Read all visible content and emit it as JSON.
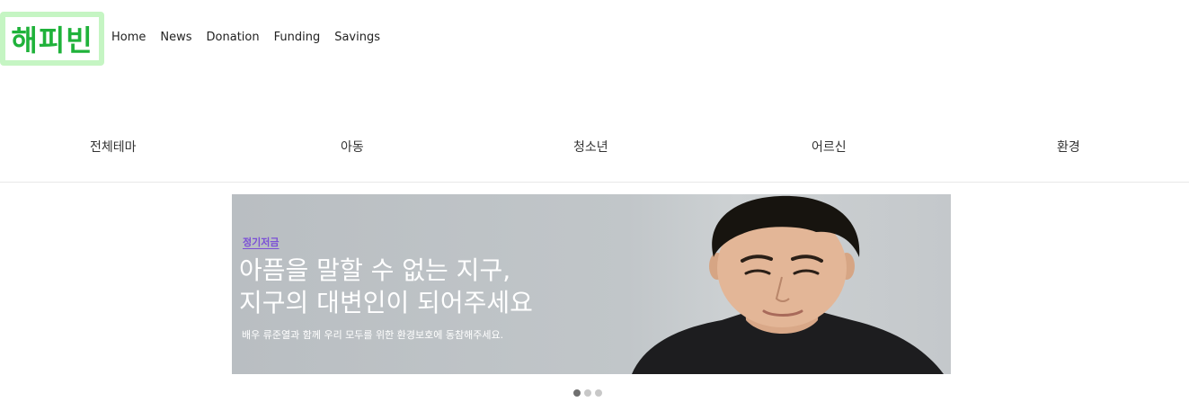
{
  "logo": {
    "text": "해피빈"
  },
  "nav": {
    "items": [
      "Home",
      "News",
      "Donation",
      "Funding",
      "Savings"
    ]
  },
  "themes": {
    "tabs": [
      "전체테마",
      "아동",
      "청소년",
      "어르신",
      "환경"
    ]
  },
  "banner": {
    "tag": "정기저금",
    "title_line1": "아픔을 말할 수 없는 지구,",
    "title_line2": "지구의 대변인이 되어주세요",
    "subtitle": "배우 류준열과 함께 우리 모두를 위한 환경보호에 동참해주세요."
  },
  "carousel": {
    "slide_count": 3,
    "active_index": 0
  },
  "colors": {
    "logo_green": "#1fb23a",
    "logo_frame": "#c5f5c3",
    "tag_purple": "#7b4fd6"
  }
}
